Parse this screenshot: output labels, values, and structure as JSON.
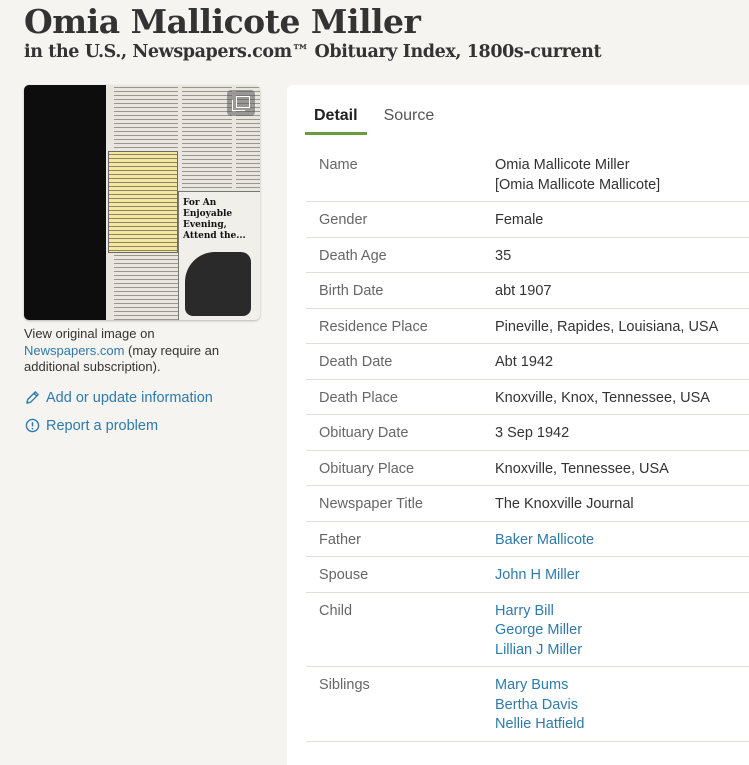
{
  "page": {
    "title": "Omia Mallicote Miller",
    "subtitle": "in the U.S., Newspapers.com™ Obituary Index, 1800s-current"
  },
  "image_panel": {
    "ad_text": "For An Enjoyable Evening, Attend the...",
    "view_text_prefix": "View original image on",
    "site_link": "Newspapers.com",
    "view_text_suffix": " (may require an additional subscription).",
    "add_update": "Add or update information",
    "report": "Report a problem"
  },
  "tabs": [
    "Detail",
    "Source"
  ],
  "details": [
    {
      "label": "Name",
      "values": [
        "Omia Mallicote Miller",
        "[Omia Mallicote Mallicote]"
      ],
      "link": false
    },
    {
      "label": "Gender",
      "values": [
        "Female"
      ],
      "link": false
    },
    {
      "label": "Death Age",
      "values": [
        "35"
      ],
      "link": false
    },
    {
      "label": "Birth Date",
      "values": [
        "abt 1907"
      ],
      "link": false
    },
    {
      "label": "Residence Place",
      "values": [
        "Pineville, Rapides, Louisiana, USA"
      ],
      "link": false
    },
    {
      "label": "Death Date",
      "values": [
        "Abt 1942"
      ],
      "link": false
    },
    {
      "label": "Death Place",
      "values": [
        "Knoxville, Knox, Tennessee, USA"
      ],
      "link": false
    },
    {
      "label": "Obituary Date",
      "values": [
        "3 Sep 1942"
      ],
      "link": false
    },
    {
      "label": "Obituary Place",
      "values": [
        "Knoxville, Tennessee, USA"
      ],
      "link": false
    },
    {
      "label": "Newspaper Title",
      "values": [
        "The Knoxville Journal"
      ],
      "link": false
    },
    {
      "label": "Father",
      "values": [
        "Baker Mallicote"
      ],
      "link": true
    },
    {
      "label": "Spouse",
      "values": [
        "John H Miller"
      ],
      "link": true
    },
    {
      "label": "Child",
      "values": [
        "Harry Bill",
        "George Miller",
        "Lillian J Miller"
      ],
      "link": true
    },
    {
      "label": "Siblings",
      "values": [
        "Mary Bums",
        "Bertha Davis",
        "Nellie Hatfield"
      ],
      "link": true
    }
  ],
  "colors": {
    "link": "#2e7aa9",
    "tab_underline": "#6b9a3f"
  },
  "icons": [
    "expand-image-icon",
    "pencil-icon",
    "alert-circle-icon"
  ]
}
